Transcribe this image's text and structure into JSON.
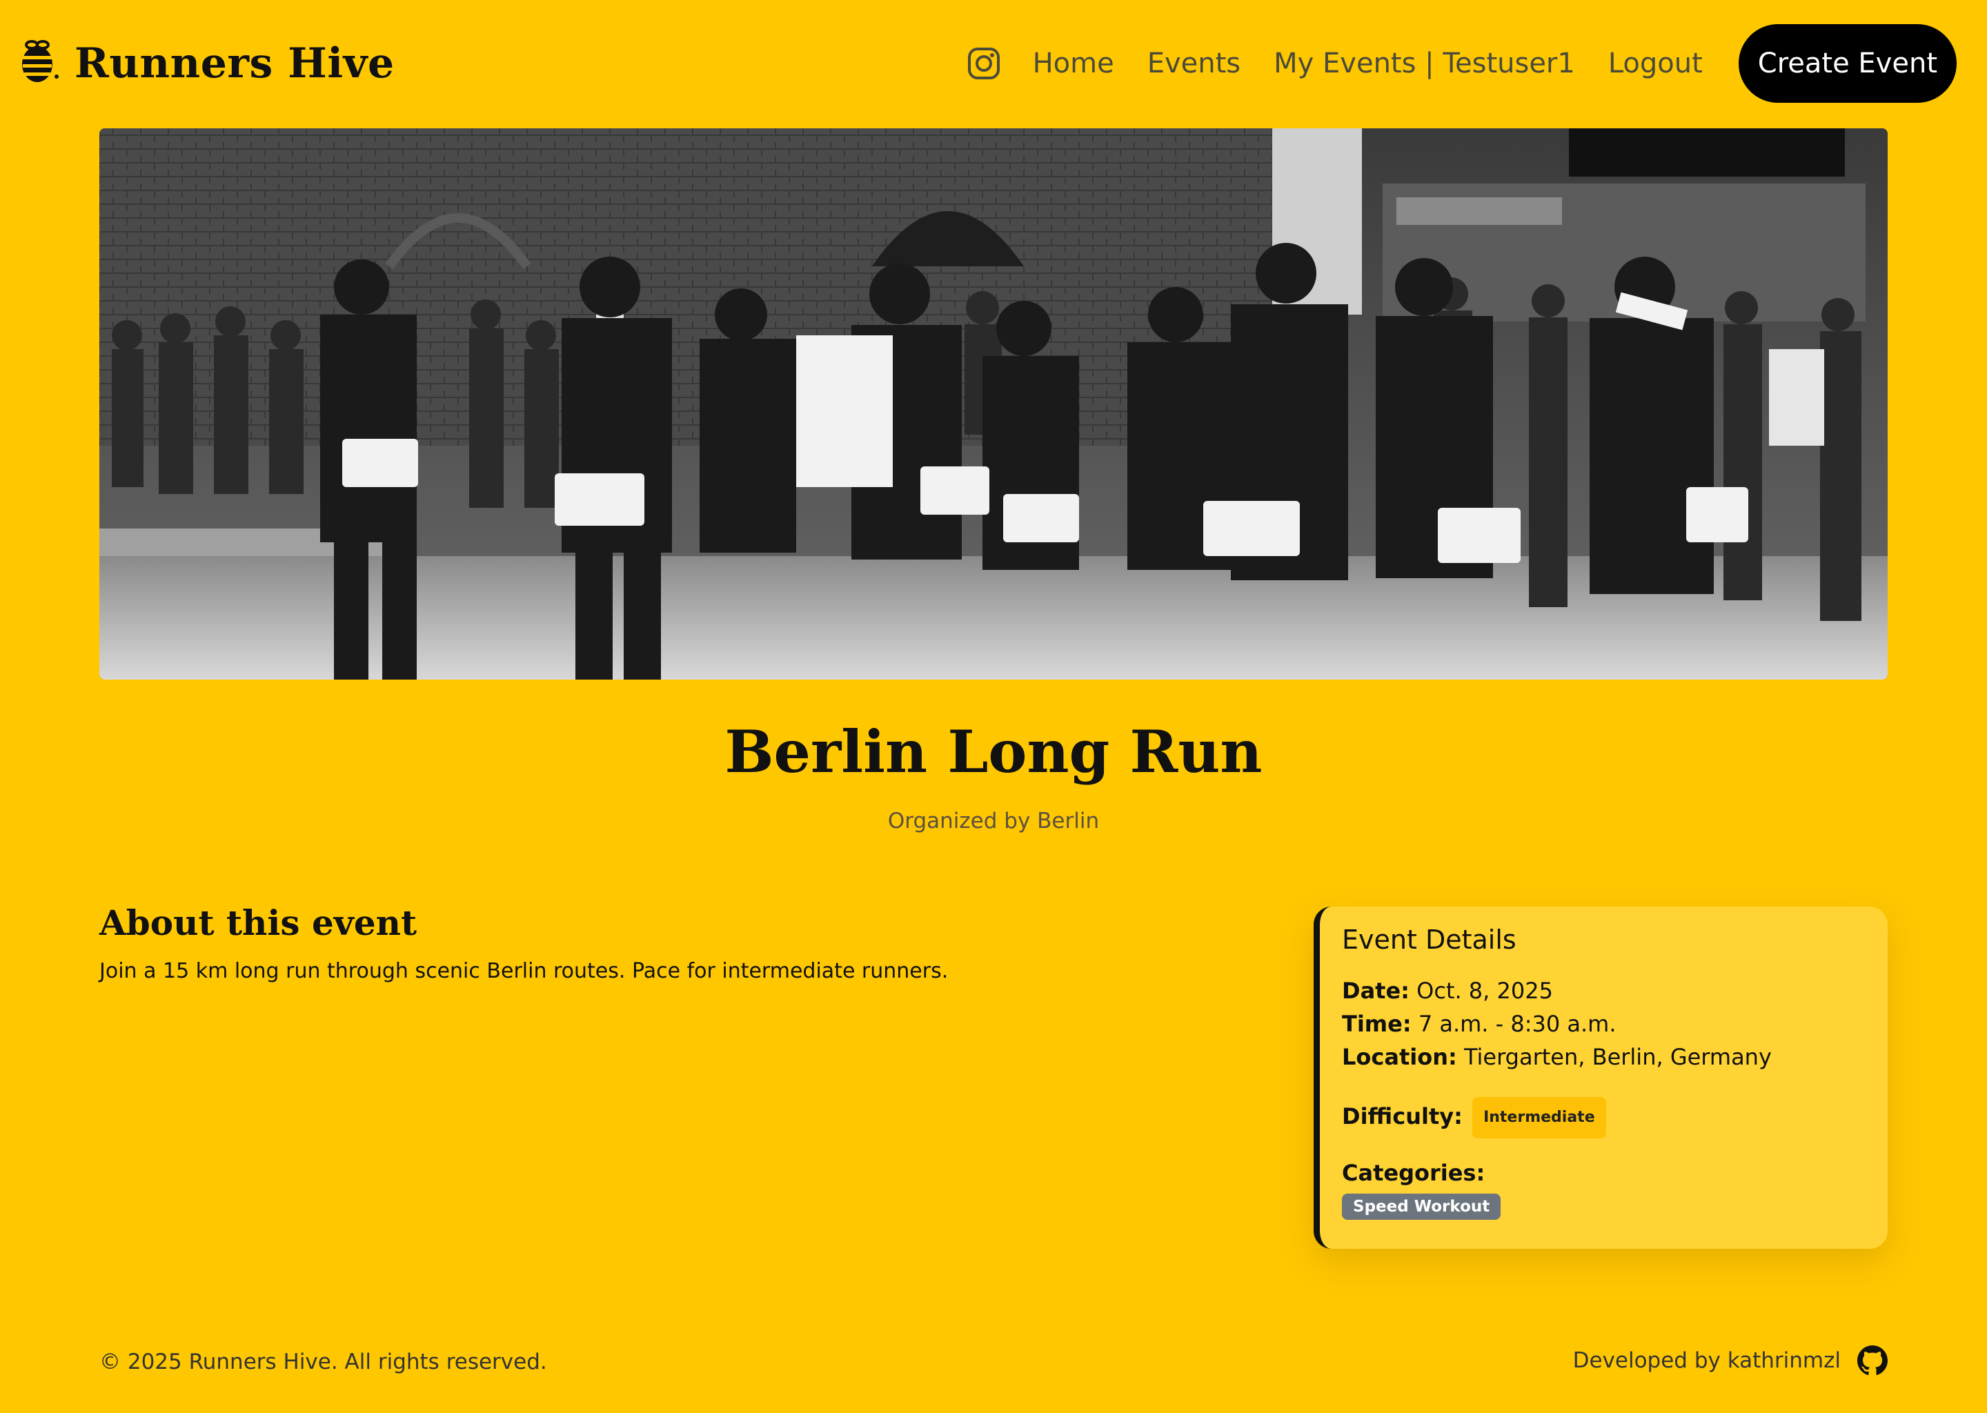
{
  "brand": {
    "name": "Runners Hive",
    "logo_icon": "bee-icon"
  },
  "nav": {
    "instagram_icon": "instagram-icon",
    "links": [
      "Home",
      "Events",
      "My Events | Testuser1",
      "Logout"
    ],
    "cta": "Create Event"
  },
  "hero": {
    "image": "grayscale marathon runners photo"
  },
  "event": {
    "title": "Berlin Long Run",
    "organizer": "Organized by Berlin",
    "about_heading": "About this event",
    "about_text": "Join a 15 km long run through scenic Berlin routes. Pace for intermediate runners."
  },
  "details": {
    "title": "Event Details",
    "date_label": "Date:",
    "date": "Oct. 8, 2025",
    "time_label": "Time:",
    "time": "7 a.m. - 8:30 a.m.",
    "location_label": "Location:",
    "location": "Tiergarten, Berlin, Germany",
    "difficulty_label": "Difficulty:",
    "difficulty": "Intermediate",
    "categories_label": "Categories:",
    "categories": [
      "Speed Workout"
    ]
  },
  "footer": {
    "copyright": "© 2025 Runners Hive. All rights reserved.",
    "developed": "Developed by kathrinmzl",
    "github_icon": "github-icon"
  },
  "colors": {
    "background": "#FFC700",
    "card": "#FFD333",
    "button": "#000000",
    "badge_intermediate": "#FFC107",
    "badge_category": "#6C757D"
  }
}
